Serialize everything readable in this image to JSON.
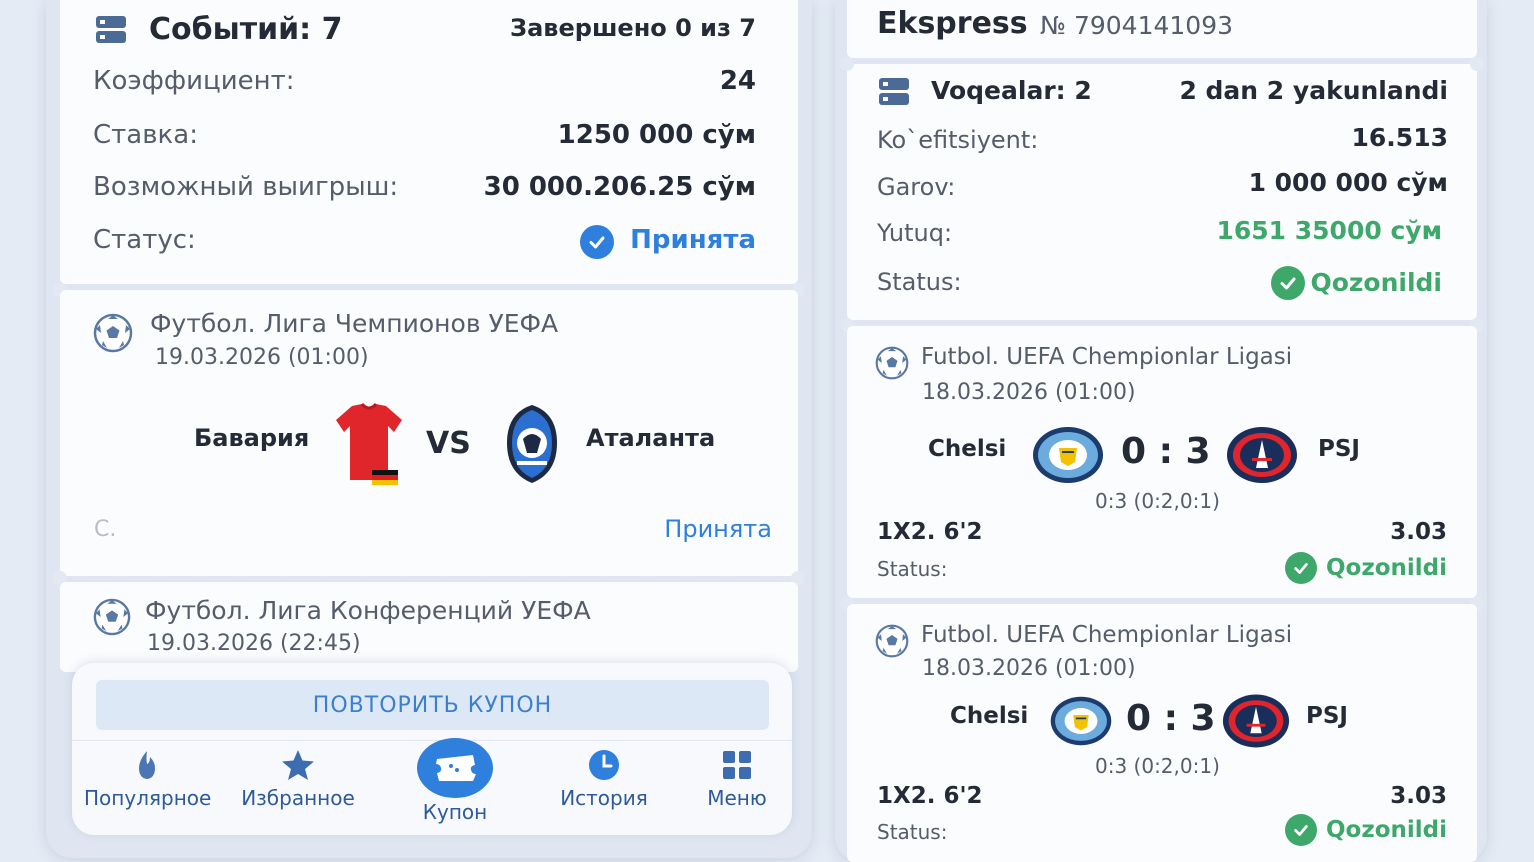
{
  "left": {
    "summary": {
      "events_label": "Событий: 7",
      "completed": "Завершено 0 из 7",
      "coef_label": "Коэффициент:",
      "coef_value": "24",
      "stake_label": "Ставка:",
      "stake_value": "1250 000 сўм",
      "win_label": "Возможный выигрыш:",
      "win_value": "30 000.206.25 сўм",
      "status_label": "Статус:",
      "status_value": "Принята"
    },
    "event1": {
      "league": "Футбол. Лига Чемпионов УЕФА",
      "datetime": "19.03.2026 (01:00)",
      "home": "Бавария",
      "vs": "VS",
      "away": "Аталанта",
      "bet_prefix": "С.",
      "status": "Принята"
    },
    "event2": {
      "league": "Футбол. Лига Конференций УЕФА",
      "datetime": "19.03.2026 (22:45)"
    },
    "repeat_button": "ПОВТОРИТЬ КУПОН",
    "nav": [
      {
        "label": "Популярное",
        "icon": "flame-icon"
      },
      {
        "label": "Избранное",
        "icon": "star-icon"
      },
      {
        "label": "Купон",
        "icon": "ticket-icon"
      },
      {
        "label": "История",
        "icon": "clock-icon"
      },
      {
        "label": "Меню",
        "icon": "grid-icon"
      }
    ]
  },
  "right": {
    "header": {
      "title": "Ekspress",
      "number": "№ 7904141093"
    },
    "summary": {
      "events_label": "Voqealar: 2",
      "completed": "2 dan 2 yakunlandi",
      "coef_label": "Ko`efitsiyent:",
      "coef_value": "16.513",
      "stake_label": "Garov:",
      "stake_value": "1 000 000 сўм",
      "win_label": "Yutuq:",
      "win_value": "1651 35000 сўм",
      "status_label": "Status:",
      "status_value": "Qozonildi"
    },
    "events": [
      {
        "league": "Futbol. UEFA Chempionlar Ligasi",
        "datetime": "18.03.2026 (01:00)",
        "home": "Chelsi",
        "score": "0 : 3",
        "away": "PSJ",
        "detail": "0:3 (0:2,0:1)",
        "market": "1X2. 6'2",
        "odd": "3.03",
        "status_label": "Status:",
        "status_value": "Qozonildi"
      },
      {
        "league": "Futbol. UEFA Chempionlar Ligasi",
        "datetime": "18.03.2026 (01:00)",
        "home": "Chelsi",
        "score": "0 : 3",
        "away": "PSJ",
        "detail": "0:3 (0:2,0:1)",
        "market": "1X2. 6'2",
        "odd": "3.03",
        "status_label": "Status:",
        "status_value": "Qozonildi"
      }
    ]
  },
  "colors": {
    "accent_blue": "#2f7fdc",
    "win_green": "#3ea86b",
    "nav_blue": "#2e5a9a"
  }
}
